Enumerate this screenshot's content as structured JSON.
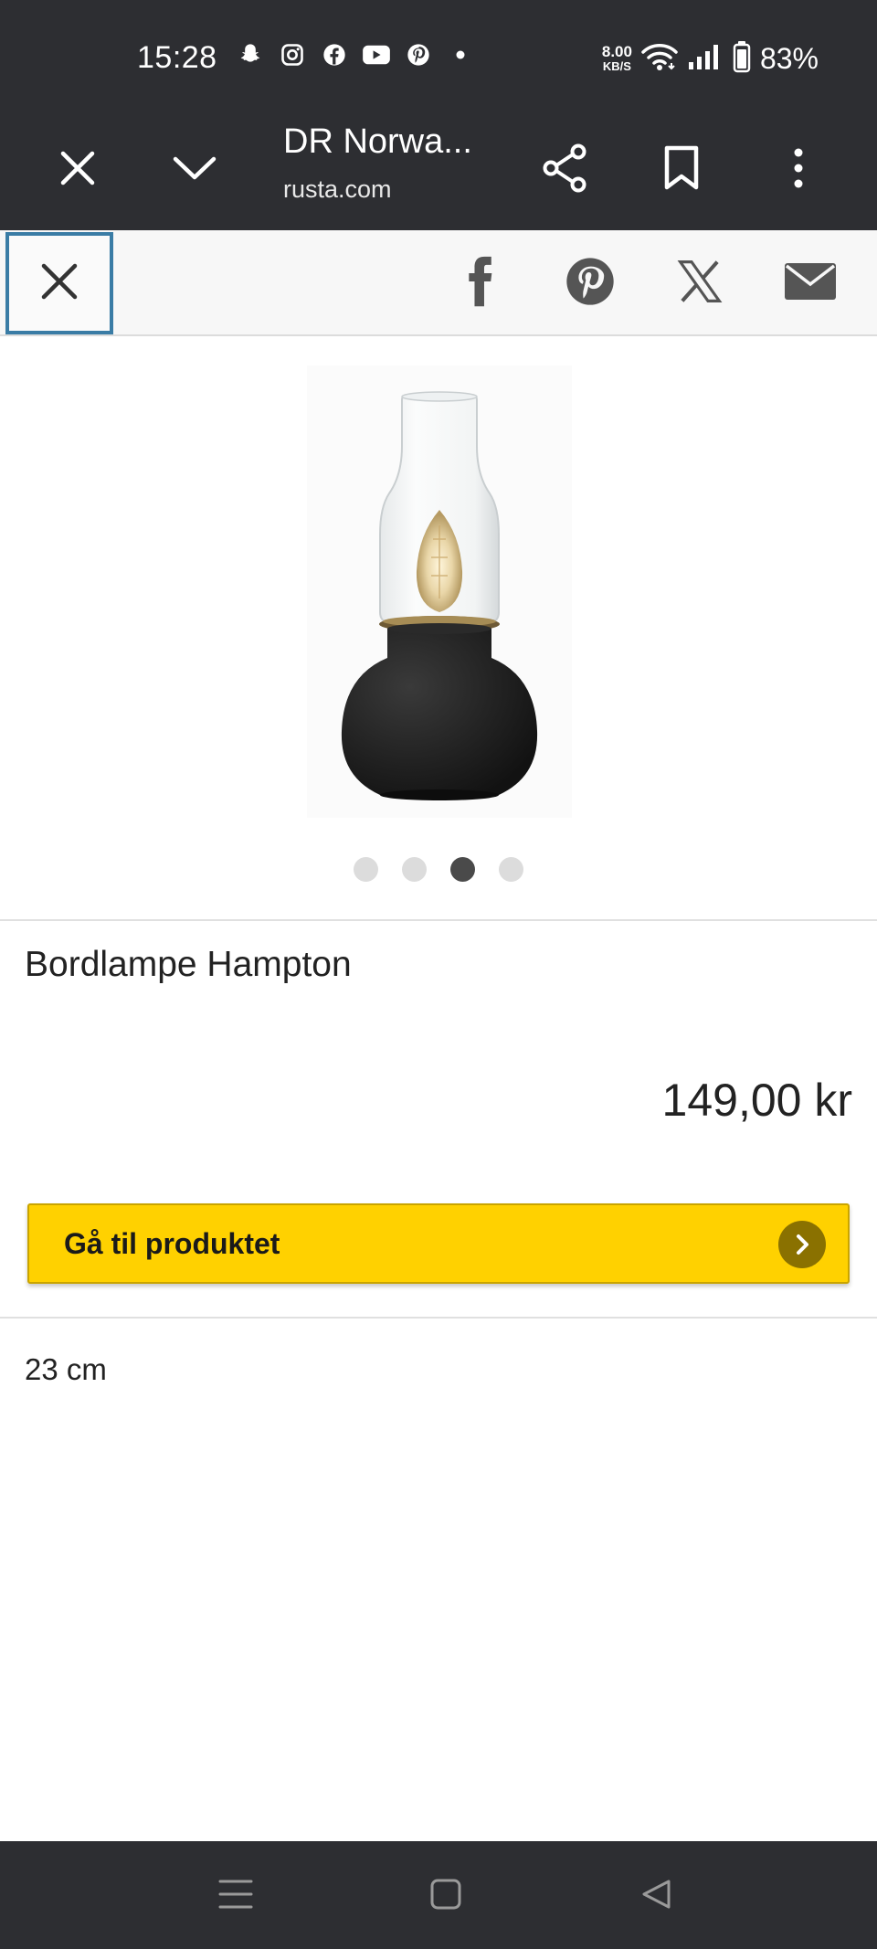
{
  "status_bar": {
    "time": "15:28",
    "notification_icons": [
      "snapchat-icon",
      "instagram-icon",
      "facebook-icon",
      "youtube-icon",
      "pinterest-icon",
      "dot-icon"
    ],
    "net_speed_value": "8.00",
    "net_speed_unit": "KB/S",
    "battery": "83%"
  },
  "toolbar": {
    "title": "DR Norwa...",
    "url": "rusta.com"
  },
  "share_bar": {
    "icons": [
      "facebook-icon",
      "pinterest-icon",
      "x-icon",
      "mail-icon"
    ]
  },
  "carousel": {
    "count": 4,
    "active_index": 2
  },
  "product": {
    "name": "Bordlampe Hampton",
    "price": "149,00 kr",
    "cta_label": "Gå til produktet",
    "size": "23 cm"
  },
  "colors": {
    "system_bar": "#2d2e32",
    "cta_yellow": "#ffd100",
    "focus_blue": "#3a7ca5"
  }
}
